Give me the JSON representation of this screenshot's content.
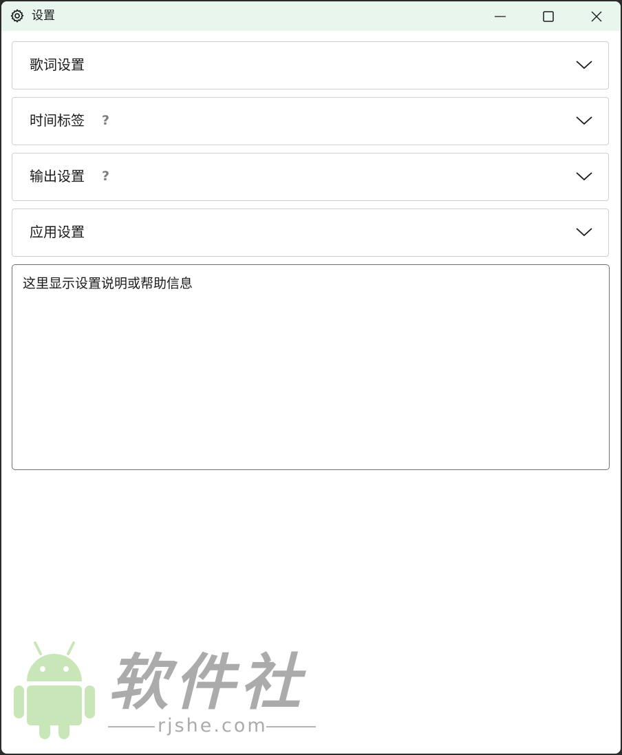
{
  "window": {
    "title": "设置",
    "icon": "gear-icon",
    "controls": [
      "minimize-icon",
      "maximize-icon",
      "close-icon"
    ]
  },
  "sections": [
    {
      "label": "歌词设置",
      "help": ""
    },
    {
      "label": "时间标签",
      "help": "?"
    },
    {
      "label": "输出设置",
      "help": "?"
    },
    {
      "label": "应用设置",
      "help": ""
    }
  ],
  "info_box": {
    "text": "这里显示设置说明或帮助信息"
  },
  "watermark": {
    "title": "软件社",
    "url": "rjshe.com",
    "icon": "android-robot-icon"
  },
  "colors": {
    "titlebar_bg": "#e8f6ee",
    "section_border": "#cfcfcf",
    "infobox_border": "#6e6e6e",
    "watermark_green": "#c9e6b8",
    "watermark_gray": "#ababab"
  }
}
